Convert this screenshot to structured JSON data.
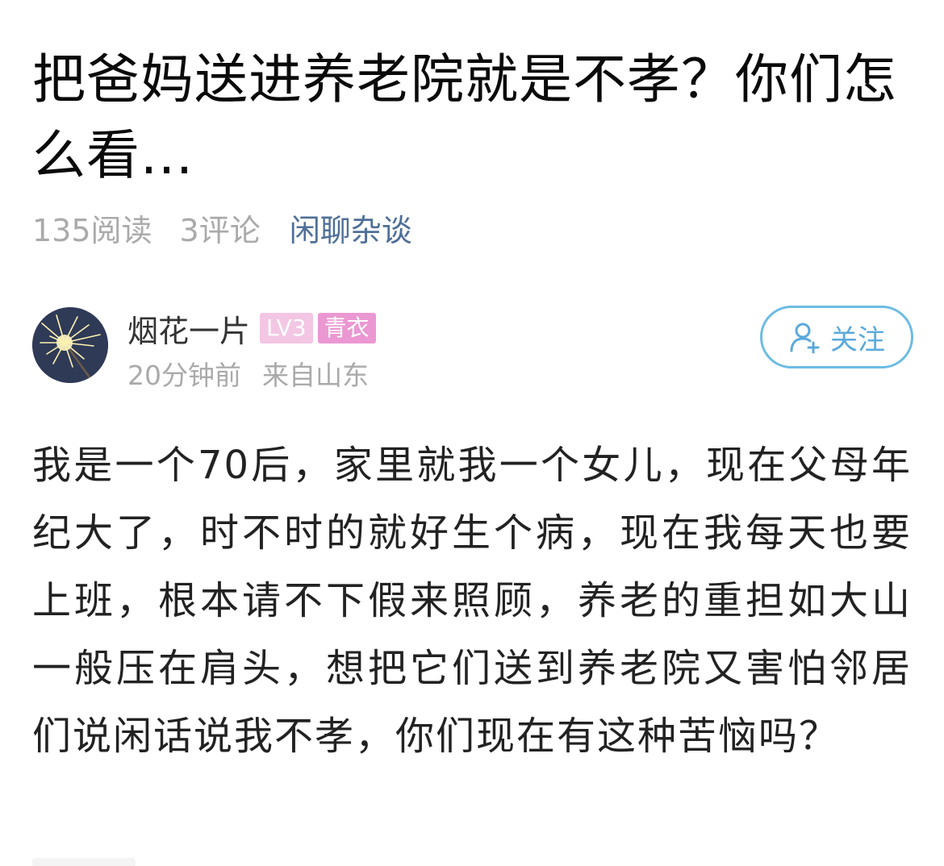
{
  "post": {
    "title": "把爸妈送进养老院就是不孝？你们怎么看...",
    "meta": {
      "reads": "135阅读",
      "comments": "3评论",
      "category": "闲聊杂谈"
    },
    "author": {
      "name": "烟花一片",
      "level_badge": "LV3",
      "title_badge": "青衣",
      "time": "20分钟前",
      "location": "来自山东",
      "avatar_icon": "sparkler-avatar"
    },
    "follow_button": {
      "label": "关注",
      "icon": "add-user-icon"
    },
    "body": "我是一个70后，家里就我一个女儿，现在父母年纪大了，时不时的就好生个病，现在我每天也要上班，根本请不下假来照顾，养老的重担如大山一般压在肩头，想把它们送到养老院又害怕邻居们说闲话说我不孝，你们现在有这种苦恼吗？"
  },
  "colors": {
    "category_link": "#4e6f98",
    "follow_accent": "#5aa9db",
    "level_badge": "#f3c6e4",
    "title_badge": "#eb98d2",
    "meta_gray": "#aaaaaa"
  }
}
